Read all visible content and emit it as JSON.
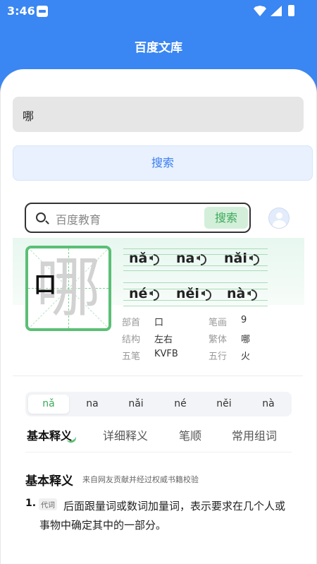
{
  "status_bar": {
    "time": "3:46"
  },
  "app_bar": {
    "title": "百度文库"
  },
  "query": {
    "value": "哪"
  },
  "search_button": {
    "label": "搜索"
  },
  "baidu_search": {
    "placeholder": "百度教育",
    "button_label": "搜索"
  },
  "character": {
    "glyph": "哪",
    "stroke_preview": "口",
    "pinyin_row1": [
      "nǎ",
      "na",
      "nǎi"
    ],
    "pinyin_row2": [
      "né",
      "něi",
      "nà"
    ],
    "info": {
      "radical_label": "部首",
      "radical": "口",
      "strokes_label": "笔画",
      "strokes": "9",
      "structure_label": "结构",
      "structure": "左右",
      "traditional_label": "繁体",
      "traditional": "哪",
      "wubi_label": "五笔",
      "wubi": "KVFB",
      "wuxing_label": "五行",
      "wuxing": "火"
    }
  },
  "pinyin_tabs": [
    "nǎ",
    "na",
    "nǎi",
    "né",
    "něi",
    "nà"
  ],
  "section_tabs": [
    "基本释义",
    "详细释义",
    "笔顺",
    "常用组词"
  ],
  "definition": {
    "title": "基本释义",
    "source": "来自网友贡献并经过权威书籍校验",
    "number": "1.",
    "tag": "代词",
    "text": "后面跟量词或数词加量词，表示要求在几个人或事物中确定其中的一部分。"
  },
  "colors": {
    "primary": "#3a86f2",
    "accent_green": "#5bbf76"
  }
}
